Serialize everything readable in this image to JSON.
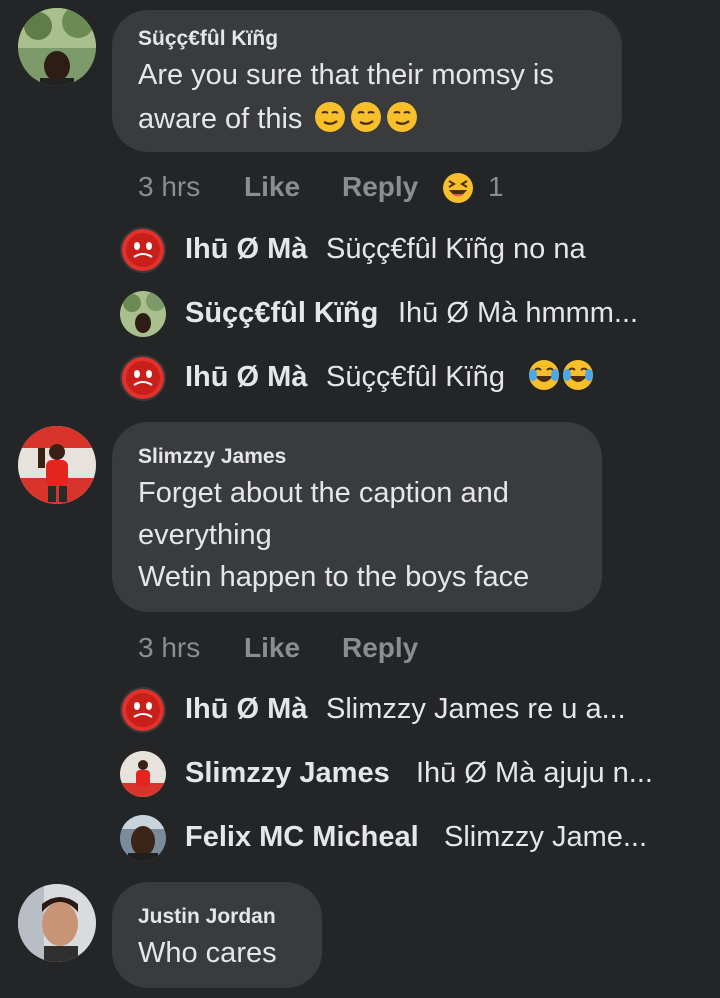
{
  "comments": [
    {
      "author": "Süçç€fûl Kïñg",
      "lines": [
        "Are you sure that their momsy is",
        "aware of this"
      ],
      "emoji": [
        "smirk-emoji",
        "smirk-emoji",
        "smirk-emoji"
      ],
      "time": "3 hrs",
      "like_label": "Like",
      "reply_label": "Reply",
      "reaction_count": "1",
      "replies": [
        {
          "name": "Ihū Ø Mà",
          "text": "Süçç€fûl Kïñg  no na",
          "emoji": []
        },
        {
          "name": "Süçç€fûl Kïñg",
          "text": "Ihū Ø Mà hmmm...",
          "emoji": []
        },
        {
          "name": "Ihū Ø Mà",
          "text": "Süçç€fûl Kïñg",
          "emoji": [
            "tears-of-joy-emoji",
            "tears-of-joy-emoji"
          ]
        }
      ]
    },
    {
      "author": "Slimzzy James",
      "lines": [
        "Forget about the caption and",
        "everything",
        "Wetin happen to the boys face"
      ],
      "time": "3 hrs",
      "like_label": "Like",
      "reply_label": "Reply",
      "replies": [
        {
          "name": "Ihū Ø Mà",
          "text": "Slimzzy James re u a..."
        },
        {
          "name": "Slimzzy James",
          "text": "Ihū Ø Mà ajuju n..."
        },
        {
          "name": "Felix MC Micheal",
          "text": "Slimzzy Jame..."
        }
      ]
    },
    {
      "author": "Justin Jordan",
      "lines": [
        "Who cares"
      ]
    }
  ],
  "colors": {
    "background": "#242526",
    "bubble": "#3a3b3c",
    "text": "#e4e6eb",
    "muted": "#8a8d91"
  }
}
